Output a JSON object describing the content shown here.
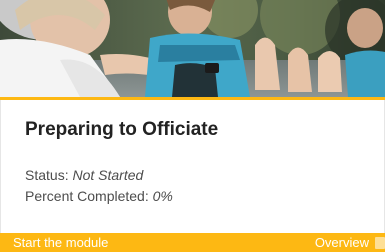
{
  "card": {
    "title": "Preparing to Officiate",
    "status_label": "Status:",
    "status_value": "Not Started",
    "percent_label": "Percent Completed:",
    "percent_value": "0%",
    "start_link": "Start the module",
    "overview_link": "Overview",
    "overview_icon": "overview-icon"
  },
  "colors": {
    "accent": "#fdb813",
    "title_text": "#222222",
    "meta_text": "#4d4d4d",
    "footer_text": "#ffffff"
  }
}
